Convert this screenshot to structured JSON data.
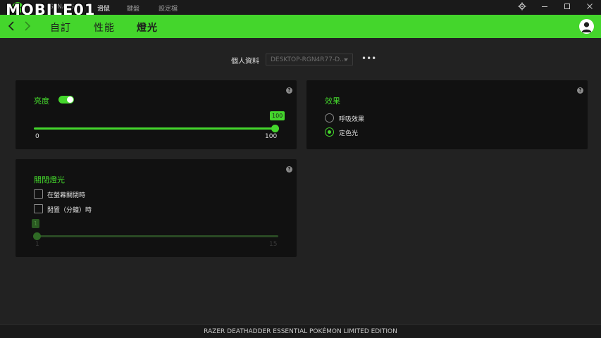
{
  "app": {
    "top_tabs": [
      "SYNAPSE",
      "滑鼠",
      "鍵盤",
      "設定檔"
    ],
    "watermark": "MOBILE01"
  },
  "nav": {
    "tabs": [
      "自訂",
      "性能",
      "燈光"
    ],
    "active_tab": "燈光"
  },
  "profile": {
    "label": "個人資料",
    "value": "DESKTOP-RGN4R77-D...",
    "more": "•••"
  },
  "brightness": {
    "title": "亮度",
    "enabled": true,
    "value": 100,
    "tip": "100",
    "min_label": "0",
    "max_label": "100",
    "min": 0,
    "max": 100
  },
  "effects": {
    "title": "效果",
    "options": [
      {
        "label": "呼吸效果",
        "selected": false
      },
      {
        "label": "定色光",
        "selected": true
      }
    ]
  },
  "lights_off": {
    "title": "關閉燈光",
    "options": [
      {
        "label": "在螢幕關閉時",
        "checked": false
      },
      {
        "label": "閒置（分鐘）時",
        "checked": false
      }
    ],
    "slider_tip": "1",
    "value": 1,
    "min_label": "1",
    "max_label": "15",
    "min": 1,
    "max": 15
  },
  "help": "?",
  "footer": {
    "device_name": "RAZER DEATHADDER ESSENTIAL POKÉMON LIMITED EDITION"
  },
  "colors": {
    "accent": "#44d62c",
    "background": "#222222",
    "panel": "#111111",
    "disabled_accent": "#2a5a22"
  },
  "icons": [
    "razer-logo-icon",
    "settings-gear-icon",
    "minimize-icon",
    "maximize-icon",
    "close-icon",
    "back-arrow-icon",
    "forward-arrow-icon",
    "user-avatar-icon",
    "help-icon",
    "dropdown-caret-icon"
  ]
}
